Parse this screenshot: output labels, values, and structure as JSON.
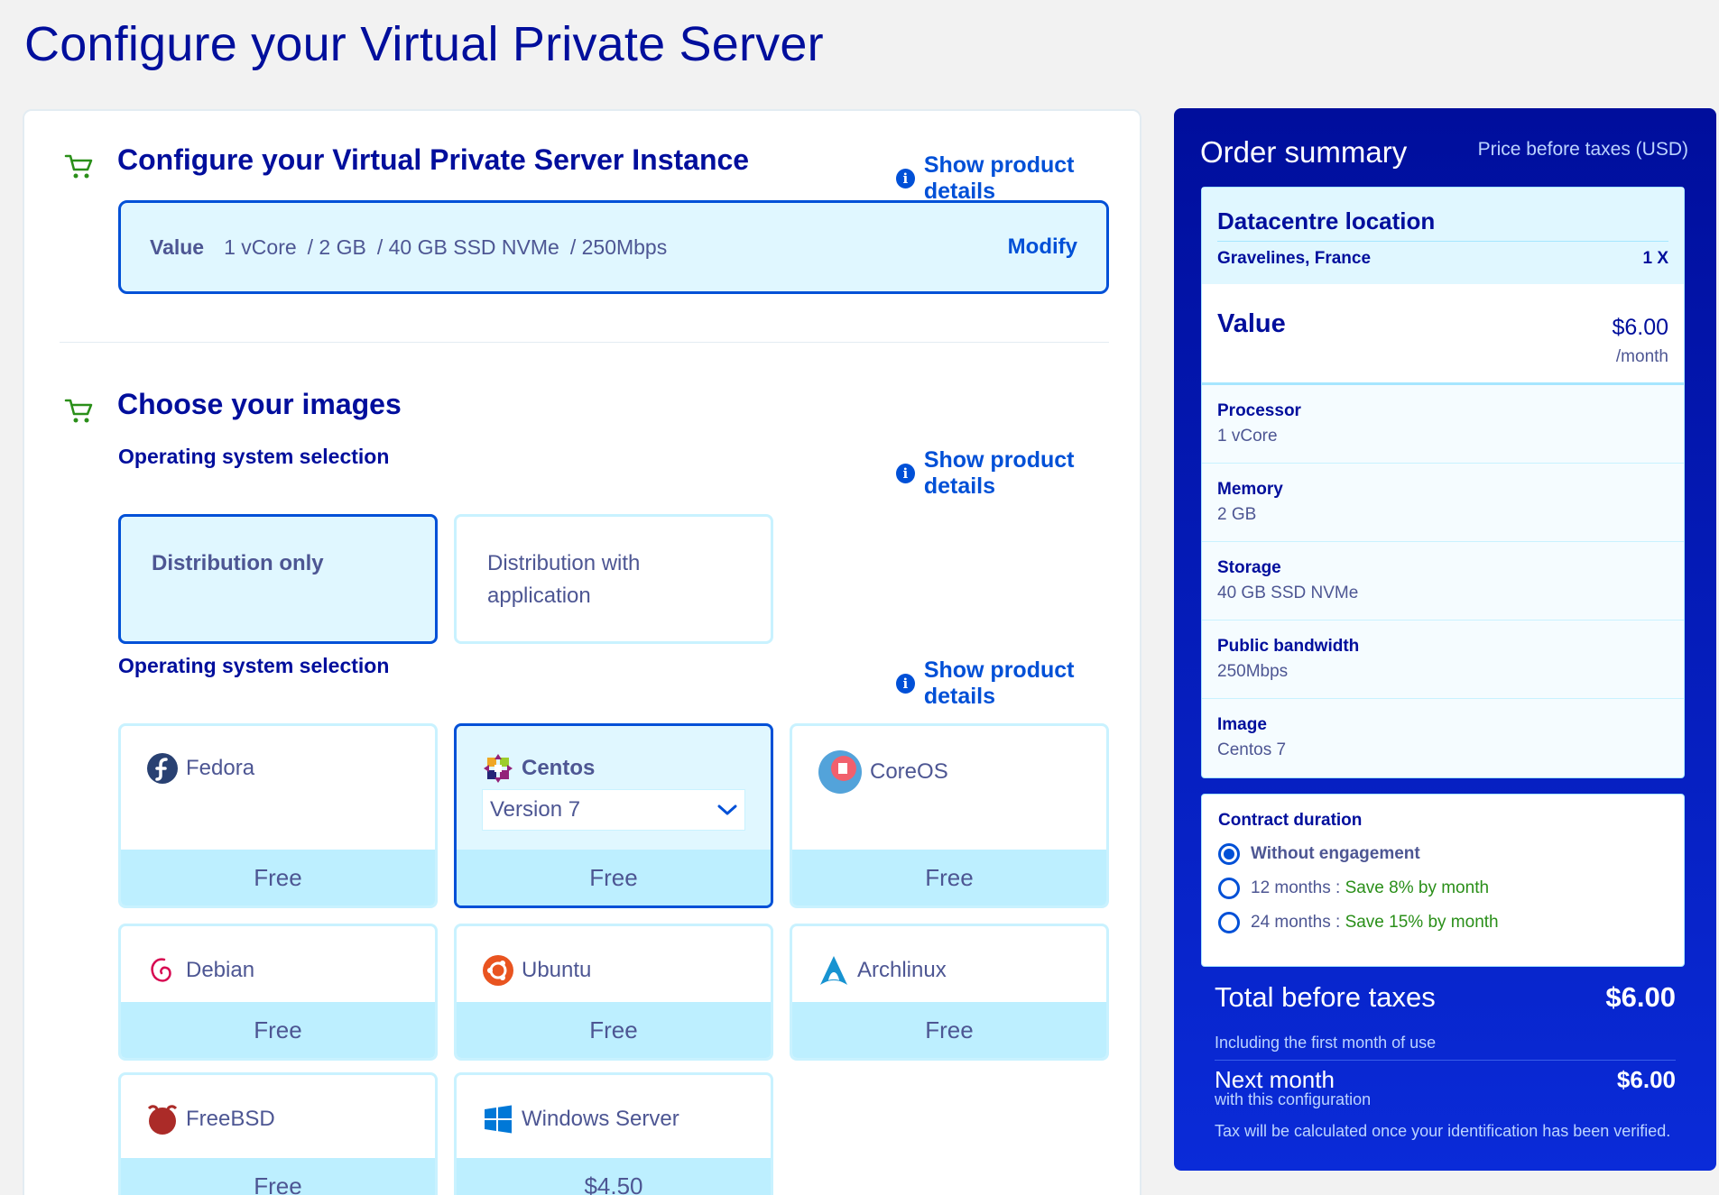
{
  "page": {
    "title": "Configure your Virtual Private Server"
  },
  "instance": {
    "title": "Configure your Virtual Private Server Instance",
    "details_link": "Show product details",
    "plan_label": "Value",
    "specs": [
      "1 vCore",
      "/ 2 GB",
      "/ 40 GB SSD NVMe",
      "/ 250Mbps"
    ],
    "modify_label": "Modify"
  },
  "images": {
    "title": "Choose your images",
    "os_selection_label": "Operating system selection",
    "details_link": "Show product details",
    "distribution_modes": [
      {
        "label": "Distribution only",
        "selected": true
      },
      {
        "label": "Distribution with application",
        "selected": false
      }
    ],
    "os_selection_label_2": "Operating system selection",
    "details_link_2": "Show product details",
    "os_options": [
      {
        "name": "Fedora",
        "price": "Free",
        "icon": "fedora-logo-icon",
        "selected": false
      },
      {
        "name": "Centos",
        "price": "Free",
        "icon": "centos-logo-icon",
        "selected": true,
        "version": "Version 7"
      },
      {
        "name": "CoreOS",
        "price": "Free",
        "icon": "coreos-logo-icon",
        "selected": false
      },
      {
        "name": "Debian",
        "price": "Free",
        "icon": "debian-logo-icon",
        "selected": false
      },
      {
        "name": "Ubuntu",
        "price": "Free",
        "icon": "ubuntu-logo-icon",
        "selected": false
      },
      {
        "name": "Archlinux",
        "price": "Free",
        "icon": "archlinux-logo-icon",
        "selected": false
      },
      {
        "name": "FreeBSD",
        "price": "Free",
        "icon": "freebsd-logo-icon",
        "selected": false
      },
      {
        "name": "Windows Server",
        "price": "$4.50",
        "icon": "windows-logo-icon",
        "selected": false
      }
    ]
  },
  "summary": {
    "title": "Order summary",
    "price_note": "Price before taxes (USD)",
    "location_title": "Datacentre location",
    "location": "Gravelines, France",
    "quantity": "1 X",
    "plan": "Value",
    "plan_price": "$6.00",
    "plan_period": "/month",
    "specs": [
      {
        "label": "Processor",
        "value": "1 vCore"
      },
      {
        "label": "Memory",
        "value": "2 GB"
      },
      {
        "label": "Storage",
        "value": "40 GB SSD NVMe"
      },
      {
        "label": "Public bandwidth",
        "value": "250Mbps"
      },
      {
        "label": "Image",
        "value": "Centos 7"
      }
    ],
    "contract": {
      "title": "Contract duration",
      "options": [
        {
          "label": "Without engagement",
          "save": "",
          "selected": true
        },
        {
          "label": "12 months : ",
          "save": "Save 8% by month",
          "selected": false
        },
        {
          "label": "24 months : ",
          "save": "Save 15% by month",
          "selected": false
        }
      ]
    },
    "total_label": "Total before taxes",
    "total_amount": "$6.00",
    "total_sub": "Including the first month of use",
    "next_label": "Next month",
    "next_amount": "$6.00",
    "next_sub": "with this configuration",
    "tax_note": "Tax will be calculated once your identification has been verified."
  },
  "colors": {
    "brand": "#000e9c",
    "accent": "#0050d7",
    "tile_bg": "#e0f7ff",
    "price_bg": "#bdefff",
    "save_green": "#2a8f19"
  }
}
